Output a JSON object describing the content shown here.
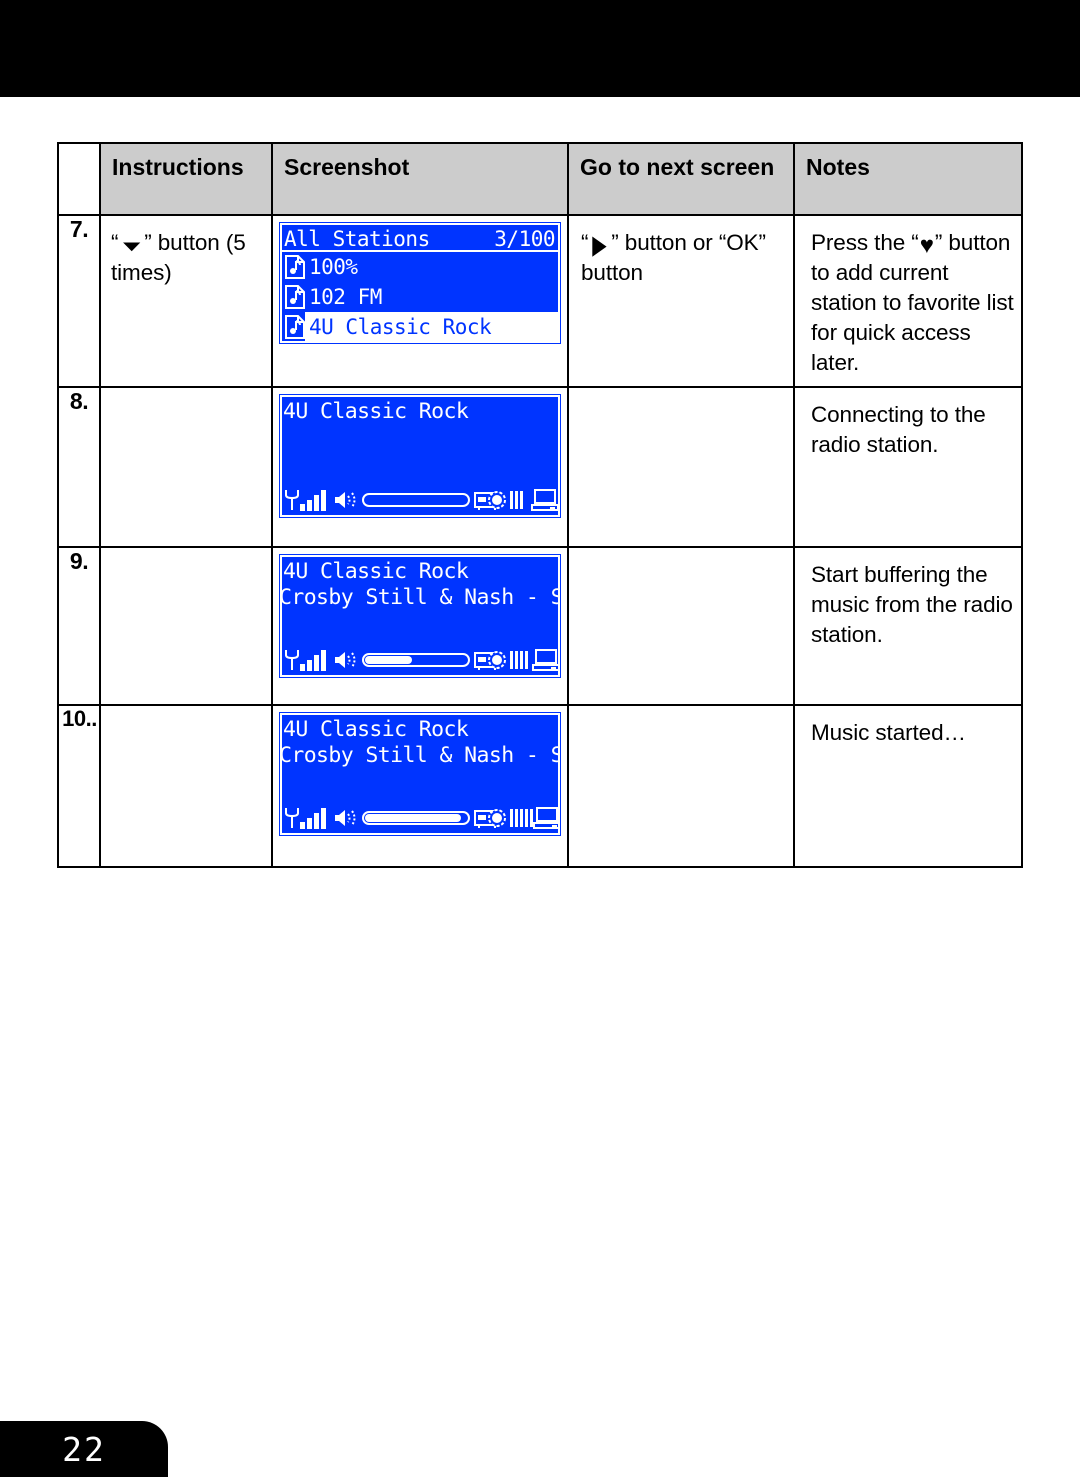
{
  "page": {
    "number": "22"
  },
  "table": {
    "headers": {
      "num": "",
      "instructions": "Instructions",
      "screenshot": "Screenshot",
      "next": "Go to next screen",
      "notes": "Notes"
    },
    "rows": [
      {
        "num": "7.",
        "instructions_pre": "“",
        "instructions_glyph": "▼",
        "instructions_post": "” button (5 times)",
        "next_pre": "“",
        "next_glyph": "▶",
        "next_post": "” button or “OK” button",
        "notes_pre": "Press the “",
        "notes_glyph": "♥",
        "notes_post": "” button to add current station to favorite list for quick access later.",
        "lcd": {
          "kind": "list",
          "header_left": "All Stations",
          "header_right": "3/100",
          "items": [
            {
              "label": "100%",
              "selected": false
            },
            {
              "label": "102 FM",
              "selected": false
            },
            {
              "label": "4U Classic Rock",
              "selected": true
            }
          ]
        }
      },
      {
        "num": "8.",
        "instructions_post": "",
        "next_post": "",
        "notes_post": "Connecting to the radio station.",
        "lcd": {
          "kind": "player",
          "title": "4U Classic Rock",
          "subtitle": "",
          "signal_bars": 4,
          "progress_percent": 0,
          "buffer_bars": 3
        }
      },
      {
        "num": "9.",
        "instructions_post": "",
        "next_post": "",
        "notes_post": "Start buffering the music from the radio station.",
        "lcd": {
          "kind": "player",
          "title": "4U Classic Rock",
          "subtitle": "Crosby Still & Nash - Sou",
          "signal_bars": 4,
          "progress_percent": 45,
          "buffer_bars": 4
        }
      },
      {
        "num": "10..",
        "instructions_post": "",
        "next_post": "",
        "notes_post": "Music started…",
        "lcd": {
          "kind": "player",
          "title": "4U Classic Rock",
          "subtitle": "Crosby Still & Nash - So",
          "signal_bars": 4,
          "progress_percent": 92,
          "buffer_bars": 5
        }
      }
    ]
  },
  "colors": {
    "lcd_background": "#0034ff",
    "lcd_foreground": "#ffffff",
    "header_background": "#cccccc",
    "band": "#000000"
  }
}
